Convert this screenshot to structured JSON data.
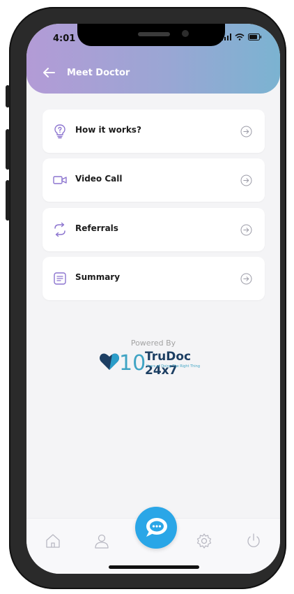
{
  "status_bar": {
    "time": "4:01"
  },
  "header": {
    "title": "Meet Doctor"
  },
  "menu": {
    "items": [
      {
        "label": "How it works?",
        "icon": "lightbulb-question-icon"
      },
      {
        "label": "Video Call",
        "icon": "video-camera-icon"
      },
      {
        "label": "Referrals",
        "icon": "refresh-arrows-icon"
      },
      {
        "label": "Summary",
        "icon": "document-list-icon"
      }
    ]
  },
  "footer": {
    "powered_by": "Powered By",
    "brand_number": "10",
    "brand_name": "TruDoc 24x7",
    "brand_tagline": "Years of Doing The Right Thing"
  },
  "nav": {
    "items": [
      "home-icon",
      "profile-icon",
      "chat-icon",
      "settings-icon",
      "power-icon"
    ]
  },
  "colors": {
    "header_left": "#b39bd6",
    "header_right": "#7bb3d1",
    "accent": "#2aa6e7",
    "icon_purple": "#8c74cf",
    "brand_navy": "#1d3f63"
  }
}
